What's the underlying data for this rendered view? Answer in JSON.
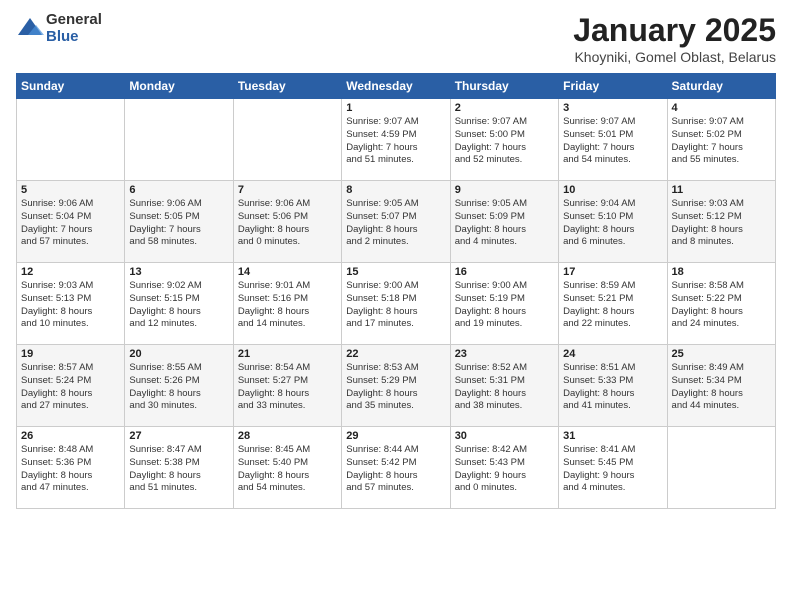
{
  "logo": {
    "general": "General",
    "blue": "Blue"
  },
  "title": "January 2025",
  "subtitle": "Khoyniki, Gomel Oblast, Belarus",
  "weekdays": [
    "Sunday",
    "Monday",
    "Tuesday",
    "Wednesday",
    "Thursday",
    "Friday",
    "Saturday"
  ],
  "weeks": [
    [
      {
        "day": "",
        "info": ""
      },
      {
        "day": "",
        "info": ""
      },
      {
        "day": "",
        "info": ""
      },
      {
        "day": "1",
        "info": "Sunrise: 9:07 AM\nSunset: 4:59 PM\nDaylight: 7 hours\nand 51 minutes."
      },
      {
        "day": "2",
        "info": "Sunrise: 9:07 AM\nSunset: 5:00 PM\nDaylight: 7 hours\nand 52 minutes."
      },
      {
        "day": "3",
        "info": "Sunrise: 9:07 AM\nSunset: 5:01 PM\nDaylight: 7 hours\nand 54 minutes."
      },
      {
        "day": "4",
        "info": "Sunrise: 9:07 AM\nSunset: 5:02 PM\nDaylight: 7 hours\nand 55 minutes."
      }
    ],
    [
      {
        "day": "5",
        "info": "Sunrise: 9:06 AM\nSunset: 5:04 PM\nDaylight: 7 hours\nand 57 minutes."
      },
      {
        "day": "6",
        "info": "Sunrise: 9:06 AM\nSunset: 5:05 PM\nDaylight: 7 hours\nand 58 minutes."
      },
      {
        "day": "7",
        "info": "Sunrise: 9:06 AM\nSunset: 5:06 PM\nDaylight: 8 hours\nand 0 minutes."
      },
      {
        "day": "8",
        "info": "Sunrise: 9:05 AM\nSunset: 5:07 PM\nDaylight: 8 hours\nand 2 minutes."
      },
      {
        "day": "9",
        "info": "Sunrise: 9:05 AM\nSunset: 5:09 PM\nDaylight: 8 hours\nand 4 minutes."
      },
      {
        "day": "10",
        "info": "Sunrise: 9:04 AM\nSunset: 5:10 PM\nDaylight: 8 hours\nand 6 minutes."
      },
      {
        "day": "11",
        "info": "Sunrise: 9:03 AM\nSunset: 5:12 PM\nDaylight: 8 hours\nand 8 minutes."
      }
    ],
    [
      {
        "day": "12",
        "info": "Sunrise: 9:03 AM\nSunset: 5:13 PM\nDaylight: 8 hours\nand 10 minutes."
      },
      {
        "day": "13",
        "info": "Sunrise: 9:02 AM\nSunset: 5:15 PM\nDaylight: 8 hours\nand 12 minutes."
      },
      {
        "day": "14",
        "info": "Sunrise: 9:01 AM\nSunset: 5:16 PM\nDaylight: 8 hours\nand 14 minutes."
      },
      {
        "day": "15",
        "info": "Sunrise: 9:00 AM\nSunset: 5:18 PM\nDaylight: 8 hours\nand 17 minutes."
      },
      {
        "day": "16",
        "info": "Sunrise: 9:00 AM\nSunset: 5:19 PM\nDaylight: 8 hours\nand 19 minutes."
      },
      {
        "day": "17",
        "info": "Sunrise: 8:59 AM\nSunset: 5:21 PM\nDaylight: 8 hours\nand 22 minutes."
      },
      {
        "day": "18",
        "info": "Sunrise: 8:58 AM\nSunset: 5:22 PM\nDaylight: 8 hours\nand 24 minutes."
      }
    ],
    [
      {
        "day": "19",
        "info": "Sunrise: 8:57 AM\nSunset: 5:24 PM\nDaylight: 8 hours\nand 27 minutes."
      },
      {
        "day": "20",
        "info": "Sunrise: 8:55 AM\nSunset: 5:26 PM\nDaylight: 8 hours\nand 30 minutes."
      },
      {
        "day": "21",
        "info": "Sunrise: 8:54 AM\nSunset: 5:27 PM\nDaylight: 8 hours\nand 33 minutes."
      },
      {
        "day": "22",
        "info": "Sunrise: 8:53 AM\nSunset: 5:29 PM\nDaylight: 8 hours\nand 35 minutes."
      },
      {
        "day": "23",
        "info": "Sunrise: 8:52 AM\nSunset: 5:31 PM\nDaylight: 8 hours\nand 38 minutes."
      },
      {
        "day": "24",
        "info": "Sunrise: 8:51 AM\nSunset: 5:33 PM\nDaylight: 8 hours\nand 41 minutes."
      },
      {
        "day": "25",
        "info": "Sunrise: 8:49 AM\nSunset: 5:34 PM\nDaylight: 8 hours\nand 44 minutes."
      }
    ],
    [
      {
        "day": "26",
        "info": "Sunrise: 8:48 AM\nSunset: 5:36 PM\nDaylight: 8 hours\nand 47 minutes."
      },
      {
        "day": "27",
        "info": "Sunrise: 8:47 AM\nSunset: 5:38 PM\nDaylight: 8 hours\nand 51 minutes."
      },
      {
        "day": "28",
        "info": "Sunrise: 8:45 AM\nSunset: 5:40 PM\nDaylight: 8 hours\nand 54 minutes."
      },
      {
        "day": "29",
        "info": "Sunrise: 8:44 AM\nSunset: 5:42 PM\nDaylight: 8 hours\nand 57 minutes."
      },
      {
        "day": "30",
        "info": "Sunrise: 8:42 AM\nSunset: 5:43 PM\nDaylight: 9 hours\nand 0 minutes."
      },
      {
        "day": "31",
        "info": "Sunrise: 8:41 AM\nSunset: 5:45 PM\nDaylight: 9 hours\nand 4 minutes."
      },
      {
        "day": "",
        "info": ""
      }
    ]
  ]
}
